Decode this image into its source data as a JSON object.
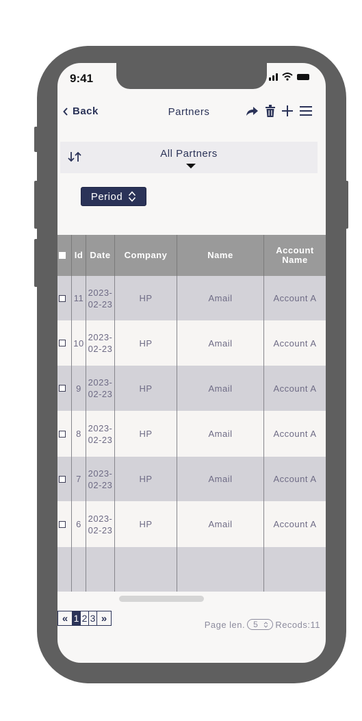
{
  "status": {
    "time": "9:41"
  },
  "nav": {
    "back_label": "Back",
    "title": "Partners"
  },
  "filter": {
    "label": "All Partners"
  },
  "period_button": {
    "label": "Period"
  },
  "table": {
    "headers": {
      "id": "Id",
      "date": "Date",
      "company": "Company",
      "name": "Name",
      "account_line1": "Account",
      "account_line2": "Name"
    },
    "rows": [
      {
        "id": "11",
        "date_line1": "2023-",
        "date_line2": "02-23",
        "company": "HP",
        "name": "Amail",
        "account": "Account A"
      },
      {
        "id": "10",
        "date_line1": "2023-",
        "date_line2": "02-23",
        "company": "HP",
        "name": "Amail",
        "account": "Account A"
      },
      {
        "id": "9",
        "date_line1": "2023-",
        "date_line2": "02-23",
        "company": "HP",
        "name": "Amail",
        "account": "Account A"
      },
      {
        "id": "8",
        "date_line1": "2023-",
        "date_line2": "02-23",
        "company": "HP",
        "name": "Amail",
        "account": "Account A"
      },
      {
        "id": "7",
        "date_line1": "2023-",
        "date_line2": "02-23",
        "company": "HP",
        "name": "Amail",
        "account": "Account A"
      },
      {
        "id": "6",
        "date_line1": "2023-",
        "date_line2": "02-23",
        "company": "HP",
        "name": "Amail",
        "account": "Account A"
      }
    ]
  },
  "pagination": {
    "first": "«",
    "last": "»",
    "pages": [
      "1",
      "2",
      "3"
    ],
    "active_page": "1",
    "page_len_label": "Page len.",
    "page_len_value": "5",
    "records_label": "Recods:11"
  },
  "colors": {
    "accent": "#2b3358",
    "header_bg": "#9a9a9a",
    "row_odd": "#d3d2d8",
    "row_even": "#f7f5f3",
    "frame": "#5f5f5f"
  },
  "icons": [
    "chevron-left-icon",
    "share-icon",
    "trash-icon",
    "plus-icon",
    "menu-icon",
    "sort-icon",
    "caret-down-icon",
    "updown-icon"
  ]
}
